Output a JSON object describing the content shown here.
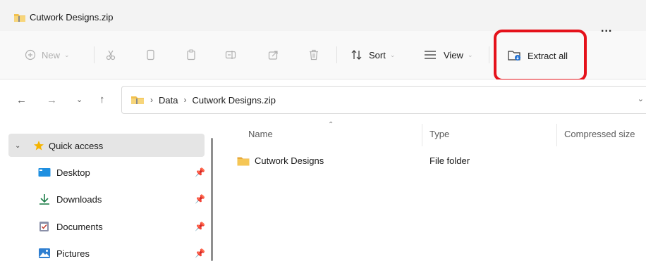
{
  "window": {
    "title": "Cutwork Designs.zip"
  },
  "toolbar": {
    "new_label": "New",
    "sort_label": "Sort",
    "view_label": "View",
    "extract_label": "Extract all",
    "more_label": "..."
  },
  "address": {
    "segments": [
      "Data",
      "Cutwork Designs.zip"
    ]
  },
  "sidebar": {
    "items": [
      {
        "label": "Quick access",
        "icon": "star-icon"
      },
      {
        "label": "Desktop",
        "icon": "desktop-icon"
      },
      {
        "label": "Downloads",
        "icon": "download-icon"
      },
      {
        "label": "Documents",
        "icon": "documents-icon"
      },
      {
        "label": "Pictures",
        "icon": "pictures-icon"
      }
    ]
  },
  "filelist": {
    "columns": {
      "name": "Name",
      "type": "Type",
      "size": "Compressed size"
    },
    "rows": [
      {
        "name": "Cutwork Designs",
        "type": "File folder"
      }
    ]
  },
  "colors": {
    "highlight": "#e5121b",
    "folder": "#f2c14e",
    "accent": "#1f6fd1"
  }
}
